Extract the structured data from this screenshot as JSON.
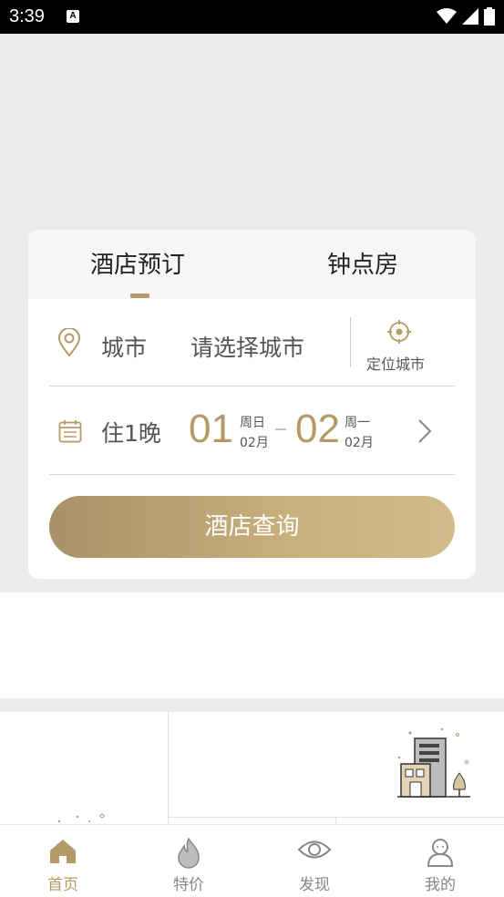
{
  "status_bar": {
    "time": "3:39",
    "notif_letter": "A"
  },
  "booking": {
    "tabs": [
      {
        "label": "酒店预订",
        "active": true
      },
      {
        "label": "钟点房",
        "active": false
      }
    ],
    "city": {
      "label": "城市",
      "value": "请选择城市",
      "locate_label": "定位城市"
    },
    "dates": {
      "nights": "住1晚",
      "checkin": {
        "day": "01",
        "weekday": "周日",
        "month": "02月"
      },
      "checkout": {
        "day": "02",
        "weekday": "周一",
        "month": "02月"
      }
    },
    "search_label": "酒店查询"
  },
  "tabbar": {
    "items": [
      {
        "label": "首页",
        "icon": "home-icon",
        "active": true
      },
      {
        "label": "特价",
        "icon": "flame-icon",
        "active": false
      },
      {
        "label": "发现",
        "icon": "eye-icon",
        "active": false
      },
      {
        "label": "我的",
        "icon": "user-icon",
        "active": false
      }
    ]
  },
  "colors": {
    "accent": "#b59a68",
    "background": "#ebebeb",
    "text": "#555555"
  }
}
